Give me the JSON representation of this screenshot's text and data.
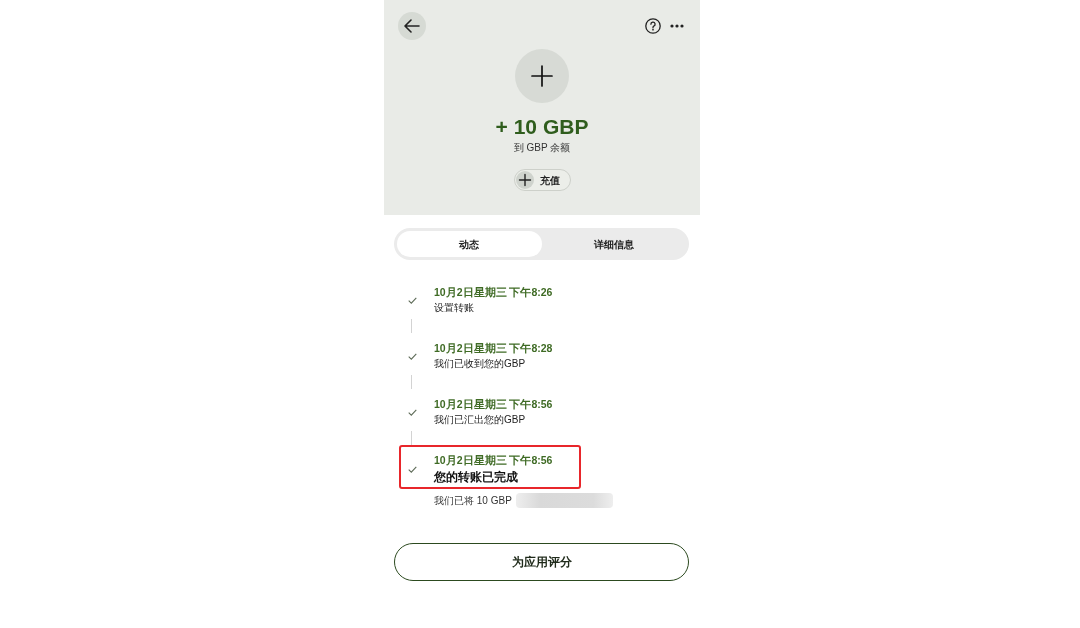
{
  "header": {
    "amount": "+ 10 GBP",
    "destination": "到 GBP 余额",
    "top_up_button": "充值"
  },
  "tabs": [
    {
      "label": "动态",
      "selected": true
    },
    {
      "label": "详细信息",
      "selected": false
    }
  ],
  "timeline": [
    {
      "kind": "step",
      "time": "10月2日星期三 下午8:26",
      "title": "设置转账",
      "done": true,
      "highlighted": false
    },
    {
      "kind": "step",
      "time": "10月2日星期三 下午8:28",
      "title": "我们已收到您的GBP",
      "done": true,
      "highlighted": false
    },
    {
      "kind": "step",
      "time": "10月2日星期三 下午8:56",
      "title": "我们已汇出您的GBP",
      "done": true,
      "highlighted": false
    },
    {
      "kind": "completed",
      "time": "10月2日星期三 下午8:56",
      "title": "您的转账已完成",
      "done": true,
      "highlighted": true,
      "note": "我们已将 10 GBP",
      "note_blurred": true
    }
  ],
  "rate_button": "为应用评分"
}
